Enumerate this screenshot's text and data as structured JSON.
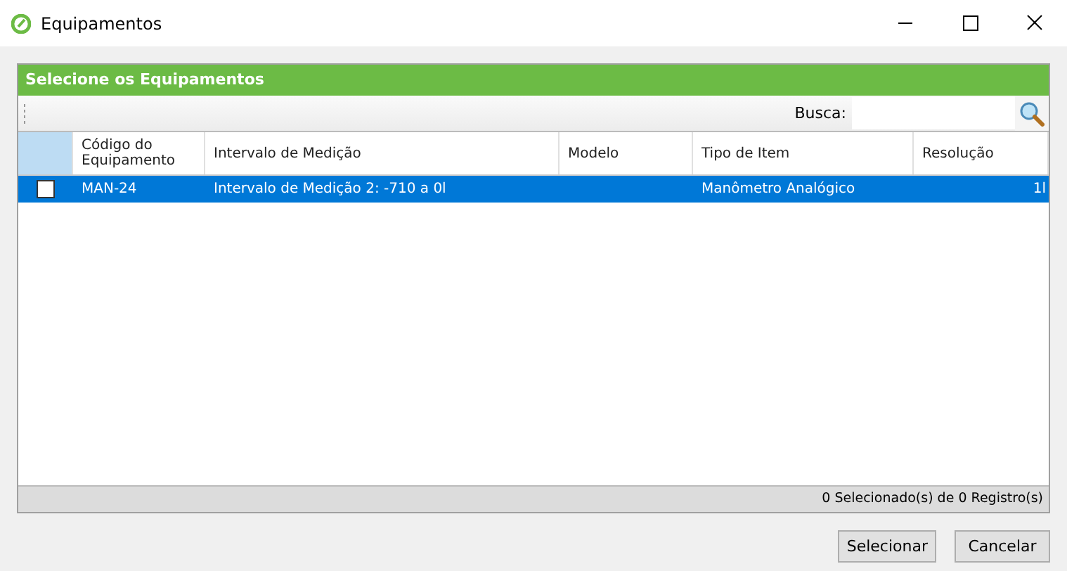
{
  "window": {
    "title": "Equipamentos"
  },
  "panel": {
    "title": "Selecione os Equipamentos"
  },
  "search": {
    "label": "Busca:"
  },
  "table": {
    "columns": [
      "Código do Equipamento",
      "Intervalo de Medição",
      "Modelo",
      "Tipo de Item",
      "Resolução"
    ],
    "rows": [
      {
        "selected": true,
        "checked": false,
        "cells": [
          "MAN-24",
          "Intervalo de Medição 2: -710 a 0l",
          "",
          "Manômetro Analógico",
          "1l"
        ]
      }
    ]
  },
  "status_bar": "0 Selecionado(s) de 0 Registro(s)",
  "buttons": [
    "Selecionar",
    "Cancelar"
  ]
}
